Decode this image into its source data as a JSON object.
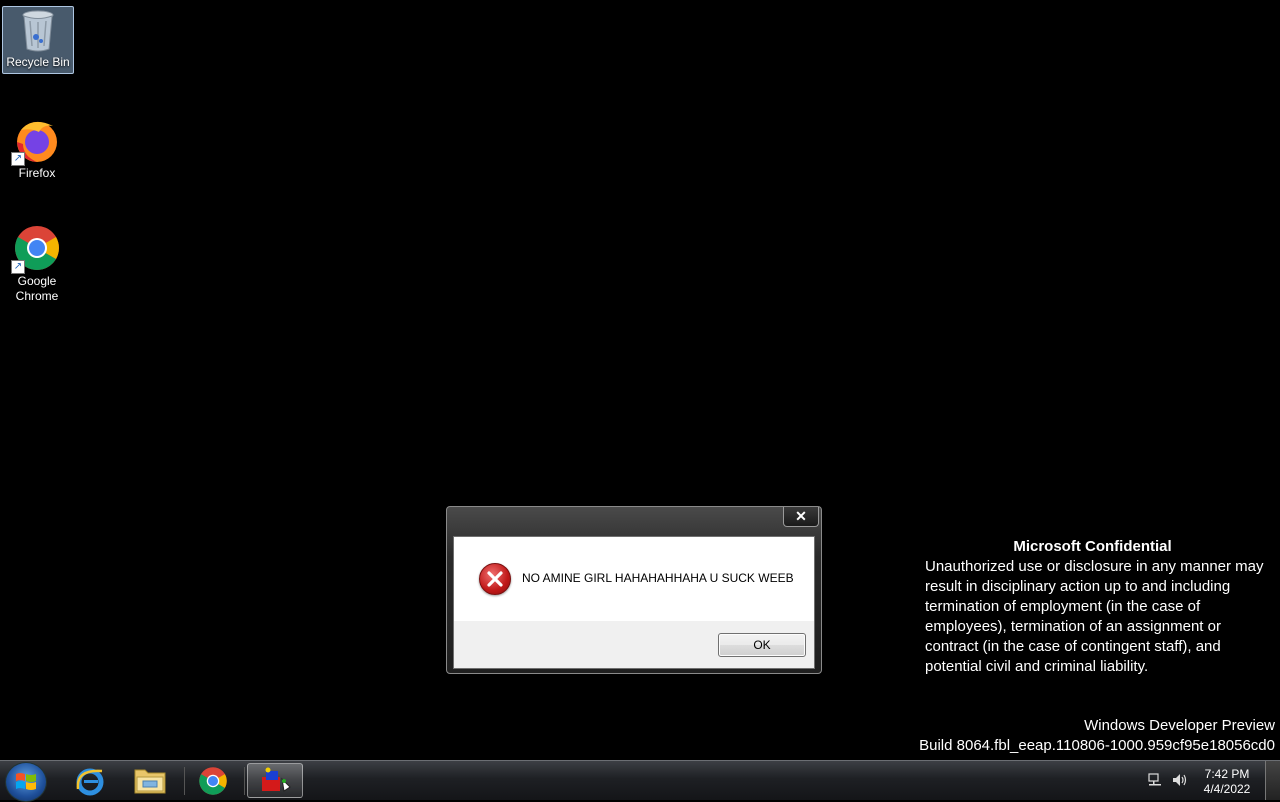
{
  "desktop": {
    "icons": [
      {
        "label": "Recycle Bin",
        "icon": "recycle-bin-icon"
      },
      {
        "label": "Firefox",
        "icon": "firefox-icon"
      },
      {
        "label": "Google Chrome",
        "icon": "chrome-icon"
      }
    ]
  },
  "dialog": {
    "message": "NO AMINE GIRL HAHAHAHHAHA U SUCK WEEB",
    "ok_label": "OK",
    "close_glyph": "✕",
    "icon": "error-icon"
  },
  "watermark": {
    "title": "Microsoft Confidential",
    "body": "Unauthorized use or disclosure in any manner may result in disciplinary action up to and including termination of employment (in the case of employees), termination of an assignment or contract (in the case of contingent staff), and potential civil and criminal liability.",
    "product": "Windows Developer Preview",
    "build": "Build 8064.fbl_eeap.110806-1000.959cf95e18056cd0"
  },
  "taskbar": {
    "items": [
      "start-orb-icon",
      "internet-explorer-icon",
      "file-explorer-icon",
      "chrome-icon",
      "app-icon"
    ],
    "time": "7:42 PM",
    "date": "4/4/2022"
  }
}
